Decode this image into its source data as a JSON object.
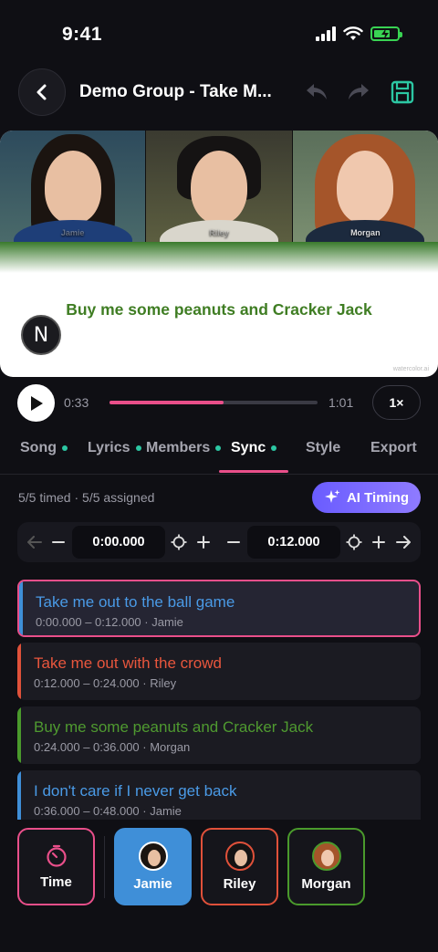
{
  "status": {
    "time": "9:41"
  },
  "header": {
    "title": "Demo Group - Take M..."
  },
  "preview": {
    "tiles": [
      {
        "name": "Jamie"
      },
      {
        "name": "Riley"
      },
      {
        "name": "Morgan"
      }
    ],
    "lyric": "Buy me some peanuts and Cracker Jack",
    "badge": "N",
    "watermark": "watercolor.ai"
  },
  "player": {
    "current": "0:33",
    "end": "1:01",
    "progress": 0.55,
    "speed": "1×"
  },
  "tabs": [
    {
      "label": "Song",
      "dot": true
    },
    {
      "label": "Lyrics",
      "dot": true
    },
    {
      "label": "Members",
      "dot": true
    },
    {
      "label": "Sync",
      "dot": true,
      "active": true
    },
    {
      "label": "Style",
      "dot": false
    },
    {
      "label": "Export",
      "dot": false
    }
  ],
  "sync": {
    "info": "5/5 timed · 5/5 assigned",
    "ai_button": "AI Timing",
    "start": "0:00.000",
    "end": "0:12.000"
  },
  "segments": [
    {
      "lyric": "Take me out to the ball game",
      "meta": "0:00.000 – 0:12.000 · Jamie",
      "color": "#3f8fd8",
      "selected": true
    },
    {
      "lyric": "Take me out with the crowd",
      "meta": "0:12.000 – 0:24.000 · Riley",
      "color": "#e0513a"
    },
    {
      "lyric": "Buy me some peanuts and Cracker Jack",
      "meta": "0:24.000 – 0:36.000 · Morgan",
      "color": "#4a9a2c"
    },
    {
      "lyric": "I don't care if I never get back",
      "meta": "0:36.000 – 0:48.000 · Jamie",
      "color": "#3f8fd8"
    }
  ],
  "assign": {
    "time_label": "Time",
    "members": [
      {
        "name": "Jamie",
        "color": "#3f8fd8"
      },
      {
        "name": "Riley",
        "color": "#e0513a"
      },
      {
        "name": "Morgan",
        "color": "#4a9a2c"
      }
    ]
  },
  "colors": {
    "accent": "#e94f8a",
    "ai": "#7b6cff",
    "dot": "#2cc7a3"
  }
}
